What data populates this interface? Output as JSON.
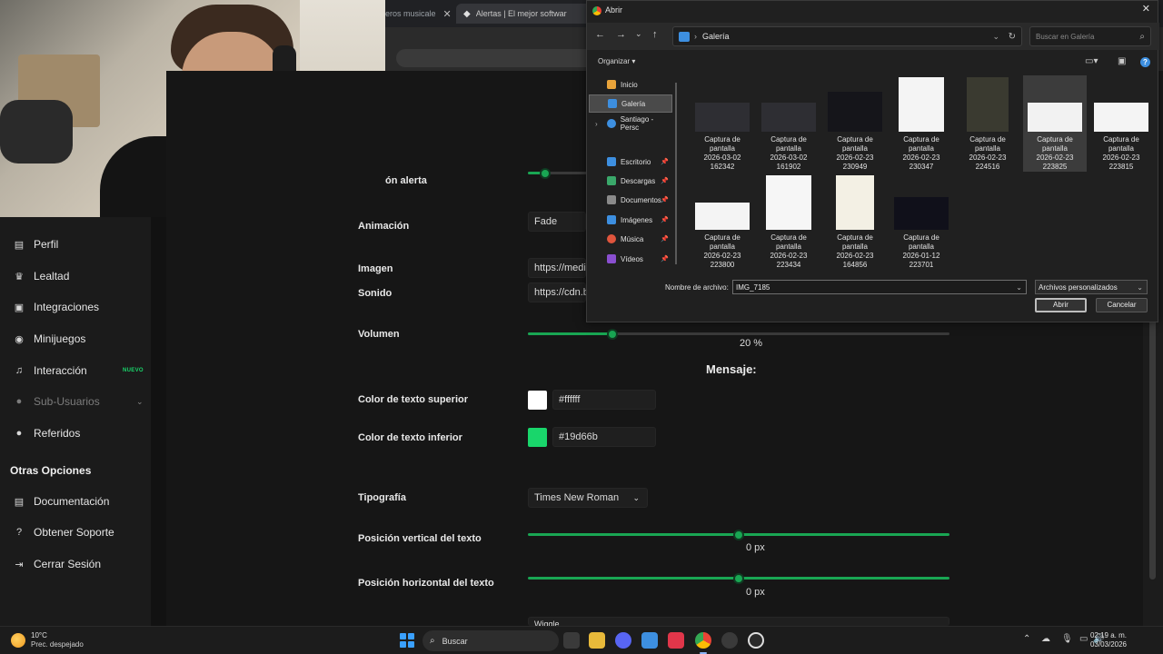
{
  "browser": {
    "tabs": [
      {
        "label": "eros musicale",
        "close": "✕"
      },
      {
        "label": "Alertas | El mejor software para",
        "close": "✕"
      }
    ]
  },
  "sidebar": {
    "items": [
      {
        "label": "Perfil",
        "icon": "id-card-icon",
        "glyph": "▤"
      },
      {
        "label": "Lealtad",
        "icon": "trophy-icon",
        "glyph": "♛"
      },
      {
        "label": "Integraciones",
        "icon": "puzzle-icon",
        "glyph": "▣"
      },
      {
        "label": "Minijuegos",
        "icon": "gamepad-icon",
        "glyph": "◉"
      },
      {
        "label": "Interacción",
        "icon": "music-icon",
        "glyph": "♫",
        "badge": "NUEVO"
      },
      {
        "label": "Sub-Usuarios",
        "icon": "users-icon",
        "glyph": "●",
        "chevron": "⌄"
      },
      {
        "label": "Referidos",
        "icon": "people-icon",
        "glyph": "●"
      }
    ],
    "section_title": "Otras Opciones",
    "other_items": [
      {
        "label": "Documentación",
        "icon": "document-icon",
        "glyph": "▤"
      },
      {
        "label": "Obtener Soporte",
        "icon": "help-icon",
        "glyph": "?"
      },
      {
        "label": "Cerrar Sesión",
        "icon": "logout-icon",
        "glyph": "⇥"
      }
    ]
  },
  "settings": {
    "duration_label": "ón alerta",
    "animation_label": "Animación",
    "animation_value": "Fade",
    "image_label": "Imagen",
    "image_value": "https://medi",
    "sound_label": "Sonido",
    "sound_value": "https://cdn.b",
    "volume_label": "Volumen",
    "volume_value": 20,
    "volume_text": "20 %",
    "message_heading": "Mensaje:",
    "top_color_label": "Color de texto superior",
    "top_color_value": "#ffffff",
    "bottom_color_label": "Color de texto inferior",
    "bottom_color_value": "#19d66b",
    "font_label": "Tipografía",
    "font_value": "Times New Roman",
    "vpos_label": "Posición vertical del texto",
    "vpos_text": "0 px",
    "hpos_label": "Posición horizontal del texto",
    "hpos_text": "0 px",
    "next_value": "Wiggle",
    "accent_color": "#19a653"
  },
  "dialog": {
    "title": "Abrir",
    "path": "Galería",
    "search_placeholder": "Buscar en Galería",
    "organize": "Organizar",
    "tree": [
      {
        "label": "Inicio",
        "icon": "home-icon",
        "color": "#e8a33a"
      },
      {
        "label": "Galería",
        "icon": "gallery-icon",
        "color": "#3d8fe0",
        "selected": true
      },
      {
        "label": "Santiago - Persc",
        "icon": "onedrive-icon",
        "color": "#3d8fe0"
      },
      {
        "label": "Escritorio",
        "icon": "desktop-icon",
        "color": "#3d8fe0"
      },
      {
        "label": "Descargas",
        "icon": "download-icon",
        "color": "#3aa86a"
      },
      {
        "label": "Documentos",
        "icon": "documents-icon",
        "color": "#8a8a8a"
      },
      {
        "label": "Imágenes",
        "icon": "pictures-icon",
        "color": "#3d8fe0"
      },
      {
        "label": "Música",
        "icon": "music-folder-icon",
        "color": "#e0553d"
      },
      {
        "label": "Vídeos",
        "icon": "videos-icon",
        "color": "#8a4fd0"
      }
    ],
    "files": [
      {
        "name": "Captura de\npantalla\n2026-03-02\n162342",
        "thumb": "#2e2e33"
      },
      {
        "name": "Captura de\npantalla\n2026-03-02\n161902",
        "thumb": "#2e2e33"
      },
      {
        "name": "Captura de\npantalla\n2026-02-23\n230949",
        "thumb": "#15151a"
      },
      {
        "name": "Captura de\npantalla\n2026-02-23\n230347",
        "thumb": "#f4f4f4"
      },
      {
        "name": "Captura de\npantalla\n2026-02-23\n224516",
        "thumb": "#3a3a30"
      },
      {
        "name": "Captura de\npantalla\n2026-02-23\n223825",
        "thumb": "#f2f2f2",
        "selected": true
      },
      {
        "name": "Captura de\npantalla\n2026-02-23\n223815",
        "thumb": "#f4f4f4"
      },
      {
        "name": "Captura de\npantalla\n2026-02-23\n223800",
        "thumb": "#f4f4f4"
      },
      {
        "name": "Captura de\npantalla\n2026-02-23\n223434",
        "thumb": "#f6f6f6"
      },
      {
        "name": "Captura de\npantalla\n2026-02-23\n164856",
        "thumb": "#f3f0e4"
      },
      {
        "name": "Captura de\npantalla\n2026-01-12\n223701",
        "thumb": "#10101a"
      }
    ],
    "filename_label": "Nombre de archivo:",
    "filename_value": "IMG_7185",
    "filetype_value": "Archivos personalizados",
    "open_button": "Abrir",
    "cancel_button": "Cancelar"
  },
  "taskbar": {
    "temperature": "10°C",
    "weather": "Prec. despejado",
    "search": "Buscar",
    "time": "02:19 a. m.",
    "date": "03/03/2026"
  }
}
